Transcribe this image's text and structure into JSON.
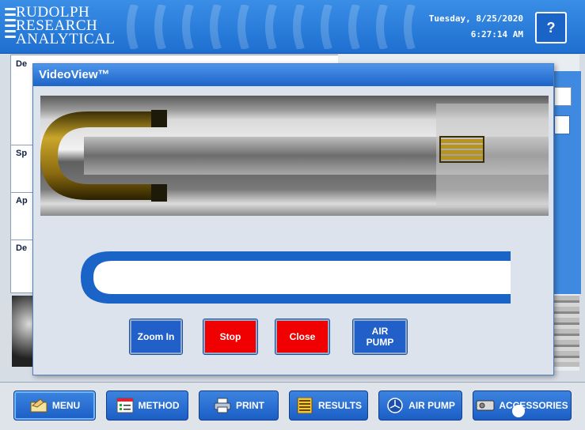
{
  "header": {
    "logo_lines": [
      "RUDOLPH",
      "RESEARCH",
      "ANALYTICAL"
    ],
    "date": "Tuesday, 8/25/2020",
    "time": "6:27:14 AM",
    "help_label": "?"
  },
  "left_panel": {
    "rows": [
      "De",
      "Sp",
      "Ap",
      "De"
    ]
  },
  "dialog": {
    "title": "VideoView™",
    "progress": 0.0,
    "buttons": [
      {
        "label": "Zoom In",
        "color": "#2060c8"
      },
      {
        "label": "Stop",
        "color": "#f00000"
      },
      {
        "label": "Close",
        "color": "#f00000"
      },
      {
        "label": "AIR PUMP",
        "color": "#2060c8"
      }
    ]
  },
  "toolbar": {
    "menu": "MENU",
    "method": "METHOD",
    "print": "PRINT",
    "results": "RESULTS",
    "air_pump": "AIR PUMP",
    "accessories": "ACCESSORIES"
  },
  "colors": {
    "accent": "#1e6fd0",
    "stop_red": "#f00000"
  }
}
